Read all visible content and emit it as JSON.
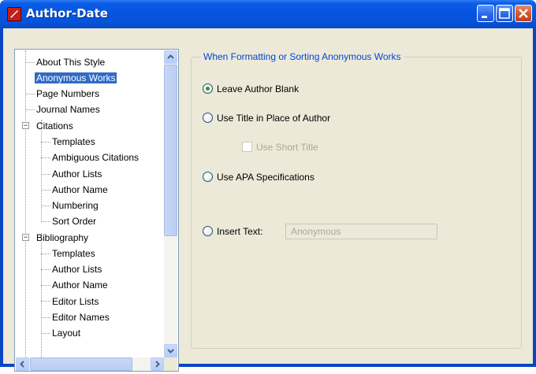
{
  "window": {
    "title": "Author-Date"
  },
  "tree": {
    "items": [
      {
        "label": "About This Style"
      },
      {
        "label": "Anonymous Works"
      },
      {
        "label": "Page Numbers"
      },
      {
        "label": "Journal Names"
      },
      {
        "label": "Citations"
      },
      {
        "label": "Templates"
      },
      {
        "label": "Ambiguous Citations"
      },
      {
        "label": "Author Lists"
      },
      {
        "label": "Author Name"
      },
      {
        "label": "Numbering"
      },
      {
        "label": "Sort Order"
      },
      {
        "label": "Bibliography"
      },
      {
        "label": "Templates"
      },
      {
        "label": "Author Lists"
      },
      {
        "label": "Author Name"
      },
      {
        "label": "Editor Lists"
      },
      {
        "label": "Editor Names"
      },
      {
        "label": "Layout"
      }
    ],
    "expander_symbol": "−"
  },
  "group": {
    "title": "When Formatting or Sorting Anonymous Works",
    "options": {
      "leave_blank": "Leave Author Blank",
      "use_title": "Use Title in Place of Author",
      "use_short_title": "Use Short Title",
      "apa": "Use APA Specifications",
      "insert_text": "Insert Text:"
    },
    "insert_text_value": "Anonymous",
    "selected_option": "leave_blank"
  },
  "colors": {
    "titlebar": "#0553d8",
    "selection": "#316ac5",
    "group_title": "#0046d5",
    "radio_dot": "#21a121"
  },
  "icons": {
    "app": "endnote-style-icon",
    "minimize": "minimize-icon",
    "maximize": "maximize-icon",
    "close": "close-icon"
  }
}
